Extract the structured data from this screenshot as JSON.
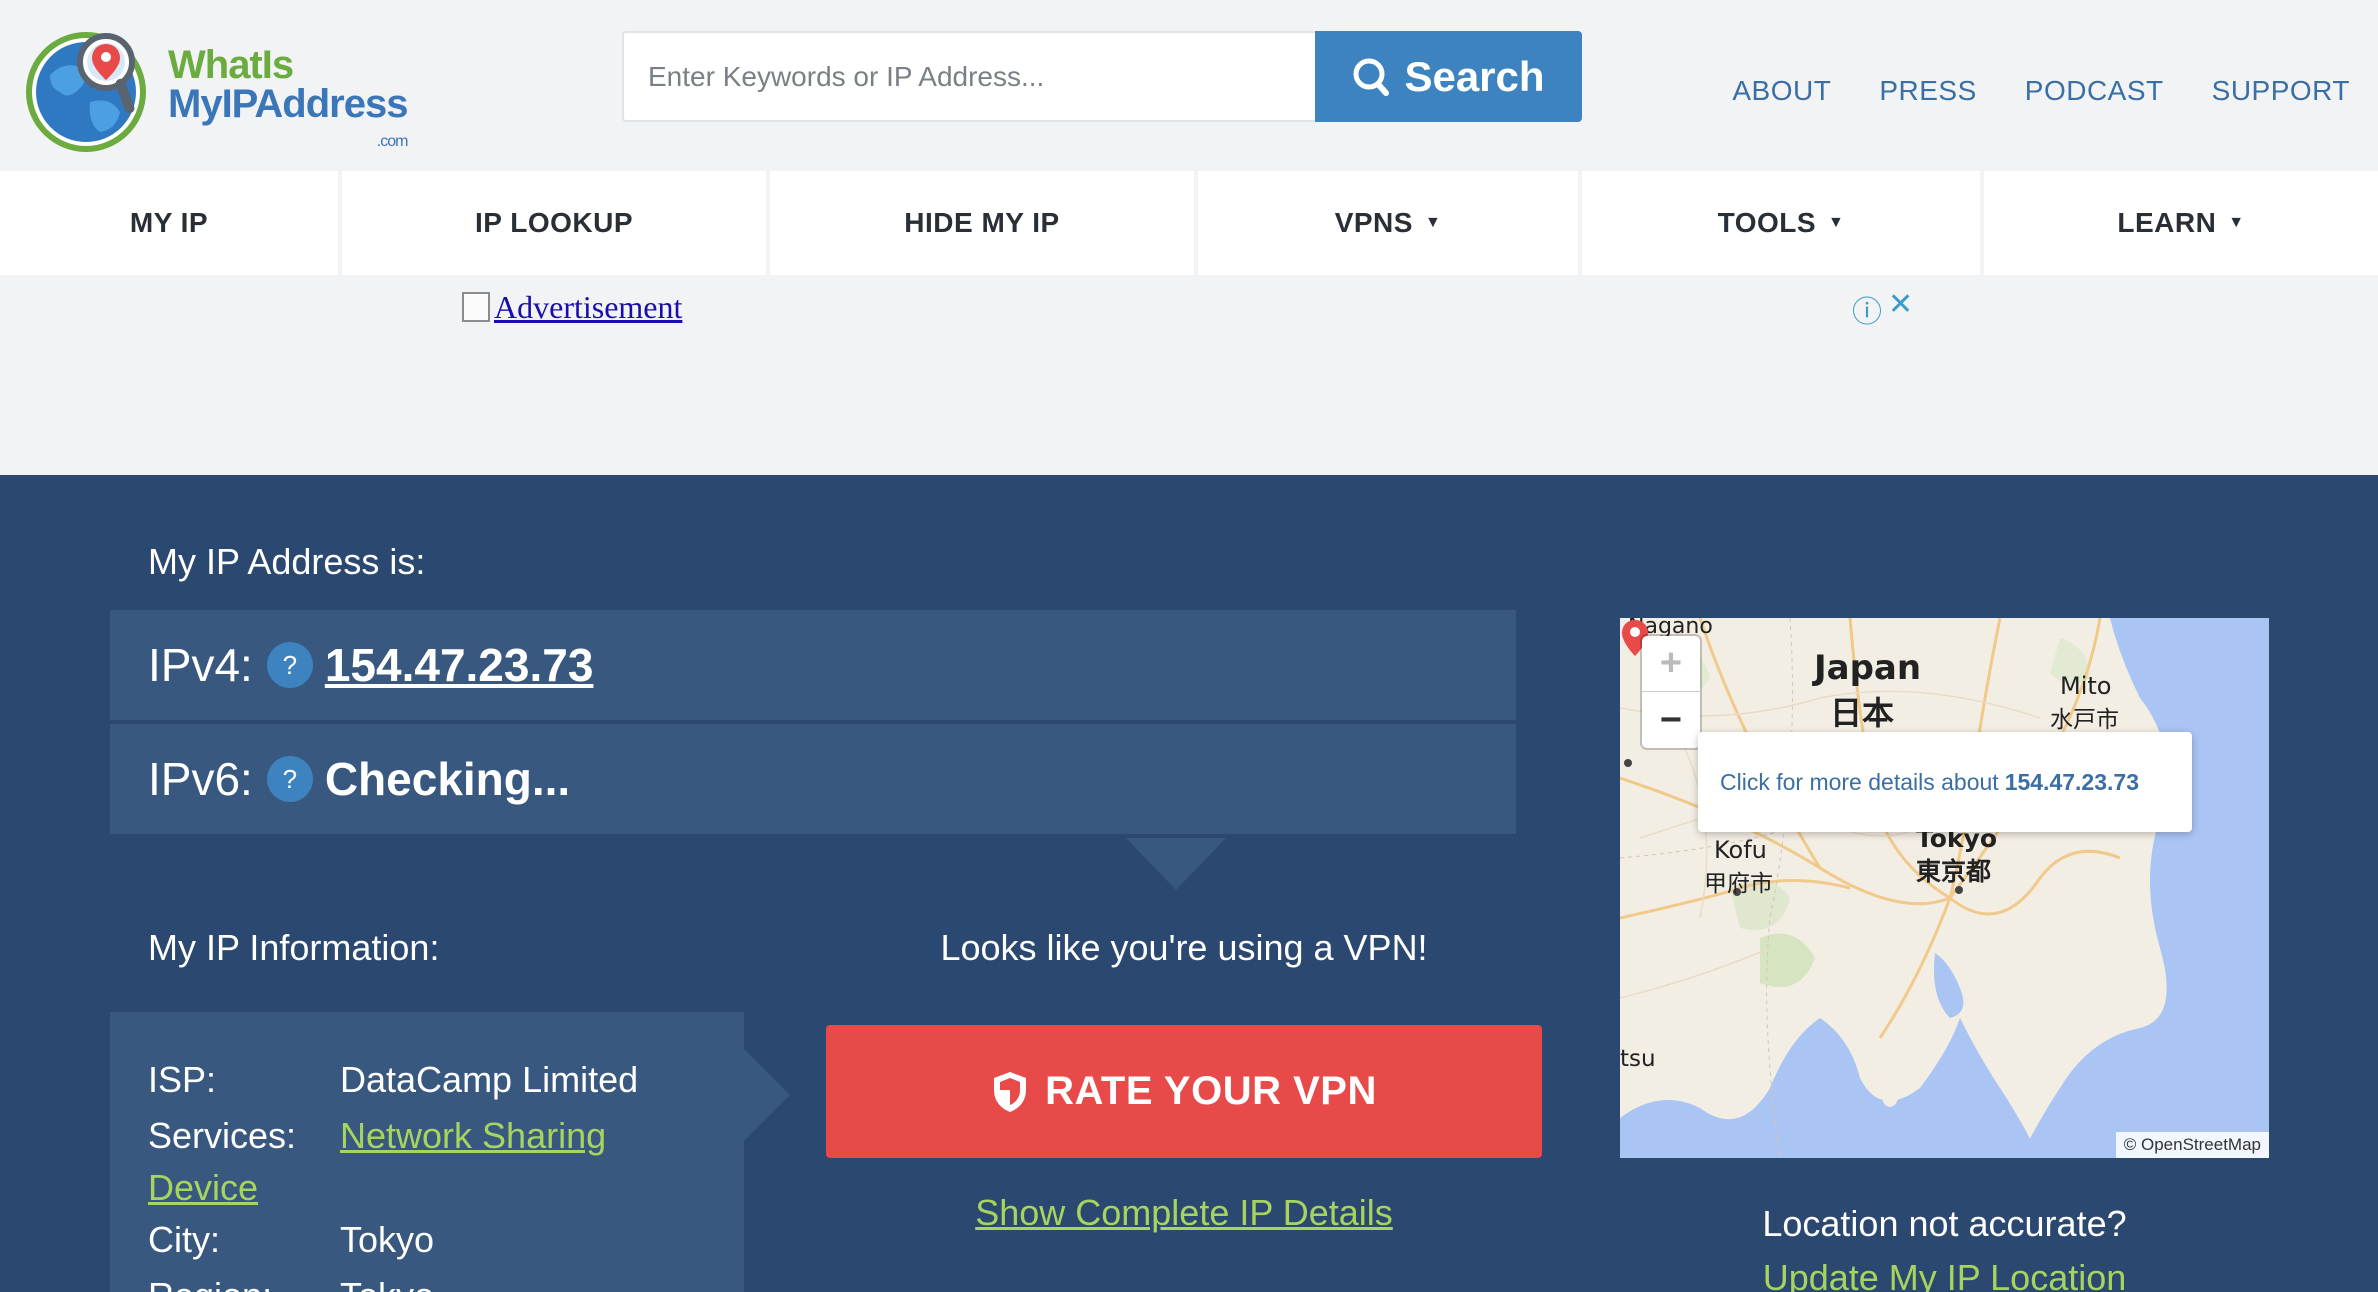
{
  "logo": {
    "line1": "WhatIs",
    "line2": "MyIPAddress",
    "line3": ".com"
  },
  "search": {
    "placeholder": "Enter Keywords or IP Address...",
    "button_label": "Search"
  },
  "top_links": [
    "ABOUT",
    "PRESS",
    "PODCAST",
    "SUPPORT"
  ],
  "nav": [
    {
      "label": "MY IP",
      "has_dropdown": false
    },
    {
      "label": "IP LOOKUP",
      "has_dropdown": false
    },
    {
      "label": "HIDE MY IP",
      "has_dropdown": false
    },
    {
      "label": "VPNS",
      "has_dropdown": true
    },
    {
      "label": "TOOLS",
      "has_dropdown": true
    },
    {
      "label": "LEARN",
      "has_dropdown": true
    }
  ],
  "ad": {
    "alt_text": "Advertisement",
    "info_icon": "ⓘ",
    "close_icon": "✕"
  },
  "ip": {
    "heading": "My IP Address is:",
    "v4_label": "IPv4:",
    "v4_value": "154.47.23.73",
    "v6_label": "IPv6:",
    "v6_value": "Checking...",
    "help": "?"
  },
  "info": {
    "heading": "My IP Information:",
    "isp_label": "ISP:",
    "isp_value": "DataCamp Limited",
    "services_label": "Services:",
    "services_value_1": "Network Sharing",
    "services_value_2": "Device",
    "city_label": "City:",
    "city_value": "Tokyo",
    "region_label": "Region:",
    "region_value": "Tokyo"
  },
  "vpn": {
    "message": "Looks like you're using a VPN!",
    "rate_button": "RATE YOUR VPN",
    "show_details": "Show Complete IP Details"
  },
  "map": {
    "popup_prefix": "Click for more details about",
    "popup_ip": "154.47.23.73",
    "labels": {
      "nagano": "Nagano",
      "japan": "Japan",
      "japan_jp": "日本",
      "mito": "Mito",
      "mito_jp": "水戸市",
      "kofu": "Kofu",
      "kofu_jp": "甲府市",
      "tokyo": "Tokyo",
      "tokyo_jp": "東京都",
      "tsu": "tsu"
    },
    "attribution": "© OpenStreetMap",
    "zoom_in": "+",
    "zoom_out": "−"
  },
  "location": {
    "question": "Location not accurate?",
    "update_link": "Update My IP Location"
  },
  "colors": {
    "hero_bg": "#2b4870",
    "panel_bg": "#39587f",
    "accent_blue": "#3d83c0",
    "link_green": "#a6d55f",
    "rate_red": "#e84a4a"
  }
}
